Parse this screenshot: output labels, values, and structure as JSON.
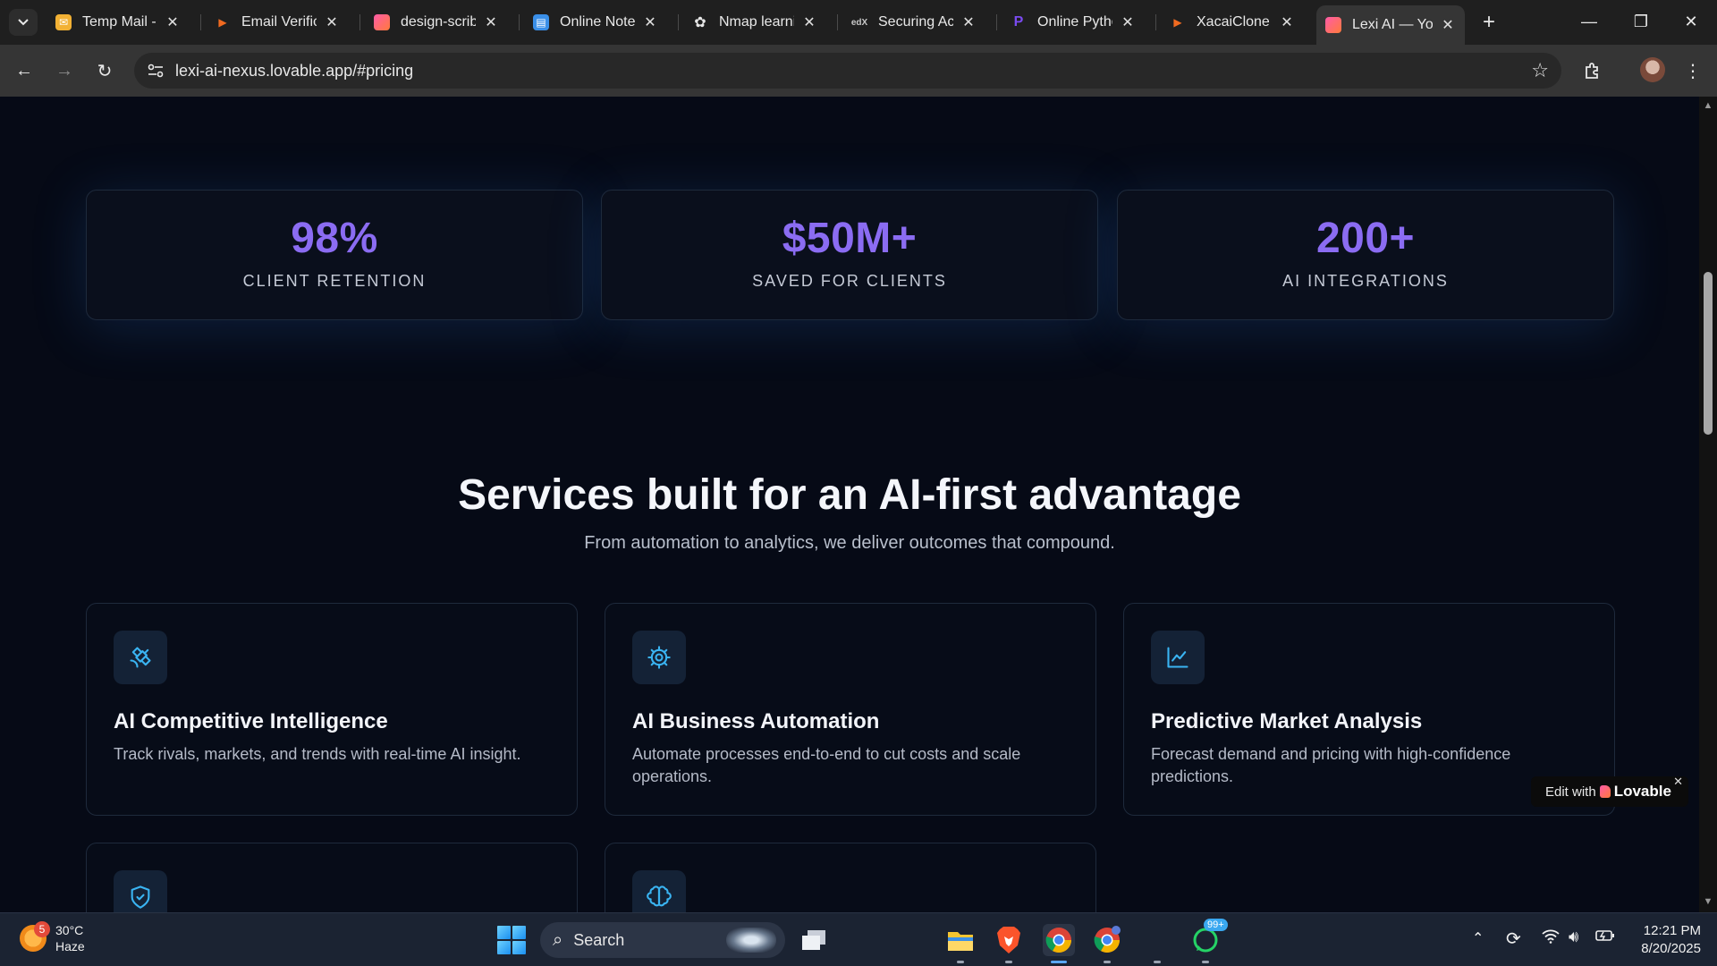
{
  "browser": {
    "tabs": [
      {
        "title": "Temp Mail - T",
        "favicon": "temp-mail-icon",
        "color": "#f2b134"
      },
      {
        "title": "Email Verifica",
        "favicon": "orange-logo-icon",
        "color": "#f06a20"
      },
      {
        "title": "design-scribe",
        "favicon": "lovable-heart-icon",
        "color": "#ff5ba8"
      },
      {
        "title": "Online Notep",
        "favicon": "notepad-icon",
        "color": "#3a8fe8"
      },
      {
        "title": "Nmap learnin",
        "favicon": "chatgpt-icon",
        "color": "#e8e8e8"
      },
      {
        "title": "Securing Acc",
        "favicon": "edx-icon",
        "color": "#c8c8c8"
      },
      {
        "title": "Online Pythor",
        "favicon": "python-p-icon",
        "color": "#7a4af0"
      },
      {
        "title": "XacaiClone -",
        "favicon": "orange-logo-icon",
        "color": "#f06a20"
      },
      {
        "title": "Lexi AI — You",
        "favicon": "lovable-heart-icon",
        "color": "#ff5ba8",
        "active": true
      }
    ],
    "url": "lexi-ai-nexus.lovable.app/#pricing"
  },
  "stats": [
    {
      "value": "98%",
      "label": "CLIENT RETENTION"
    },
    {
      "value": "$50M+",
      "label": "SAVED FOR CLIENTS"
    },
    {
      "value": "200+",
      "label": "AI INTEGRATIONS"
    }
  ],
  "services": {
    "title": "Services built for an AI-first advantage",
    "subtitle": "From automation to analytics, we deliver outcomes that compound.",
    "cards": [
      {
        "icon": "satellite-icon",
        "title": "AI Competitive Intelligence",
        "description": "Track rivals, markets, and trends with real-time AI insight."
      },
      {
        "icon": "gear-icon",
        "title": "AI Business Automation",
        "description": "Automate processes end-to-end to cut costs and scale operations."
      },
      {
        "icon": "line-chart-icon",
        "title": "Predictive Market Analysis",
        "description": "Forecast demand and pricing with high-confidence predictions."
      },
      {
        "icon": "shield-check-icon",
        "title": "",
        "description": ""
      },
      {
        "icon": "brain-icon",
        "title": "",
        "description": ""
      }
    ]
  },
  "lovable_badge": {
    "prefix": "Edit with",
    "brand": "Lovable"
  },
  "taskbar": {
    "weather_temp": "30°C",
    "weather_desc": "Haze",
    "weather_badge": "5",
    "search_label": "Search",
    "whatsapp_badge": "99+",
    "time": "12:21 PM",
    "date": "8/20/2025"
  },
  "colors": {
    "accent": "#8b6cf2",
    "icon_cyan": "#3ab4f2",
    "background": "#060a16"
  }
}
